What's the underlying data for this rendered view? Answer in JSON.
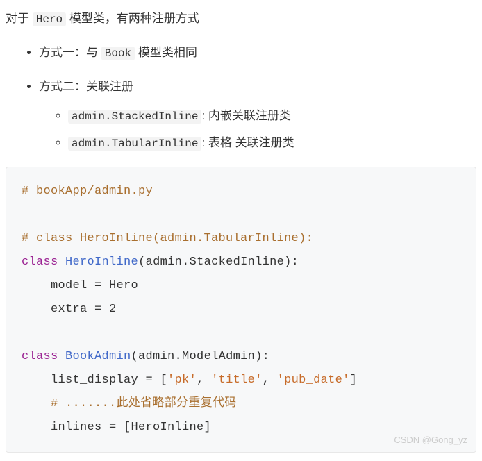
{
  "intro": {
    "prefix": "对于 ",
    "code": "Hero",
    "suffix": " 模型类，有两种注册方式"
  },
  "bullets": {
    "m1_prefix": "方式一：与 ",
    "m1_code": "Book",
    "m1_suffix": " 模型类相同",
    "m2": "方式二：关联注册",
    "m2_sub1_code": "admin.StackedInline",
    "m2_sub1_desc": ": 内嵌关联注册类",
    "m2_sub2_code": "admin.TabularInline",
    "m2_sub2_desc": ": 表格 关联注册类"
  },
  "code": {
    "l1_comment": "# bookApp/admin.py",
    "blank": "",
    "l3_comment": "# class HeroInline(admin.TabularInline):",
    "l4_kw": "class",
    "l4_name": "HeroInline",
    "l4_rest": "(admin.StackedInline):",
    "l5": "    model = Hero",
    "l6": "    extra = 2",
    "l8_kw": "class",
    "l8_name": "BookAdmin",
    "l8_rest": "(admin.ModelAdmin):",
    "l9_pre": "    list_display = [",
    "l9_s1": "'pk'",
    "l9_c": ", ",
    "l9_s2": "'title'",
    "l9_s3": "'pub_date'",
    "l9_post": "]",
    "l10_pre": "    ",
    "l10_comment": "# .......此处省略部分重复代码",
    "l11": "    inlines = [HeroInline]"
  },
  "watermark": "CSDN @Gong_yz"
}
